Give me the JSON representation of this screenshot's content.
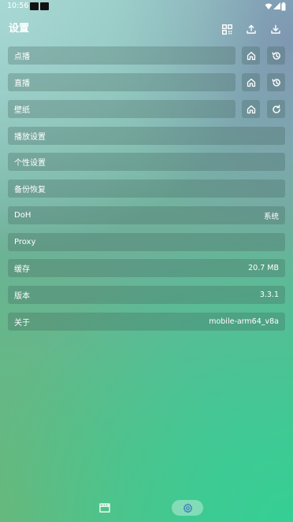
{
  "status_bar": {
    "time": "10:56"
  },
  "header": {
    "title": "设置"
  },
  "rows": {
    "vod": {
      "label": "点播"
    },
    "live": {
      "label": "直播"
    },
    "wallpaper": {
      "label": "壁纸"
    },
    "player": {
      "label": "播放设置"
    },
    "personal": {
      "label": "个性设置"
    },
    "backup": {
      "label": "备份恢复"
    },
    "doh": {
      "label": "DoH",
      "value": "系统"
    },
    "proxy": {
      "label": "Proxy"
    },
    "cache": {
      "label": "缓存",
      "value": "20.7 MB"
    },
    "version": {
      "label": "版本",
      "value": "3.3.1"
    },
    "about": {
      "label": "关于",
      "value": "mobile-arm64_v8a"
    }
  },
  "icons": {
    "header": [
      "qr-code-icon",
      "upload-icon",
      "download-icon"
    ],
    "row_actions": [
      "home-icon",
      "history-icon",
      "refresh-icon"
    ],
    "bottom_nav": [
      "clapperboard-icon",
      "gear-icon"
    ]
  },
  "colors": {
    "text": "#ffffff",
    "row_background": "rgba(60,95,85,0.28)",
    "nav_active_pill": "rgba(255,255,255,0.35)"
  }
}
